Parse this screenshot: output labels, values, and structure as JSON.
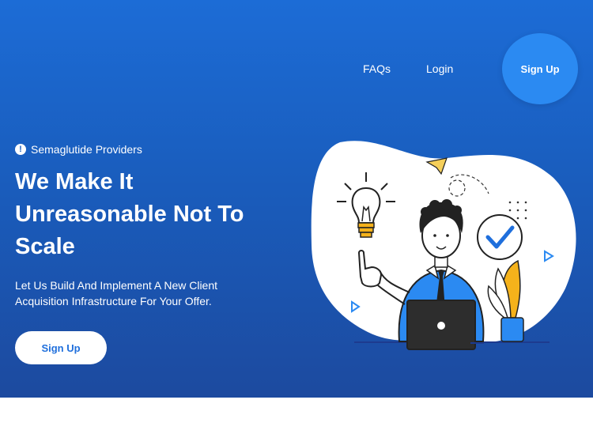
{
  "nav": {
    "faqs_label": "FAQs",
    "login_label": "Login",
    "signup_label": "Sign Up"
  },
  "hero": {
    "eyebrow": "Semaglutide Providers",
    "eyebrow_icon": "alert-circle-icon",
    "headline": "We Make It Unreasonable Not To Scale",
    "subtext": "Let Us Build And Implement A New Client Acquisition Infrastructure For Your Offer.",
    "cta_label": "Sign Up",
    "illustration": "person-with-laptop-illustration"
  },
  "colors": {
    "hero_gradient_top": "#1c6cd6",
    "hero_gradient_bottom": "#1c4a9f",
    "accent": "#2b8af2",
    "cta_text": "#1f6fdc",
    "page_background": "#ffffff"
  }
}
